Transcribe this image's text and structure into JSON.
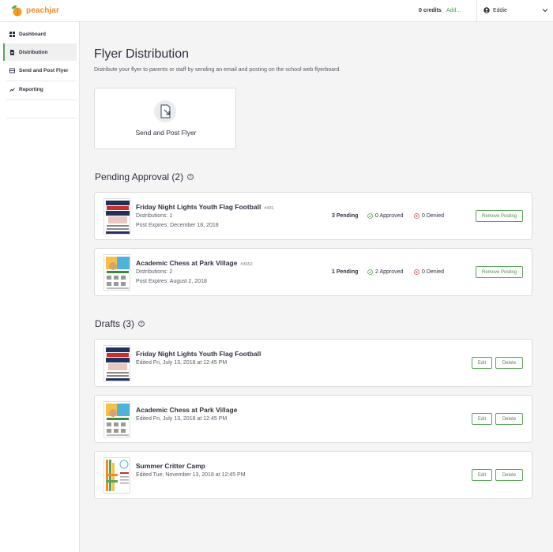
{
  "topbar": {
    "logo_text": "peachjar",
    "credits": "0 credits",
    "add_link": "Add...",
    "user_name": "Eddie"
  },
  "sidebar": {
    "items": [
      {
        "label": "Dashboard",
        "icon": "dashboard-icon",
        "active": false
      },
      {
        "label": "Distribution",
        "icon": "document-icon",
        "active": true
      },
      {
        "label": "Send and Post Flyer",
        "icon": "send-icon",
        "active": false
      },
      {
        "label": "Reporting",
        "icon": "reporting-icon",
        "active": false
      }
    ]
  },
  "main": {
    "title": "Flyer Distribution",
    "subtitle": "Distribute your flyer to parents or staff by sending an email and posting on the school web flyerboard.",
    "send_card_label": "Send and Post Flyer",
    "pending_title": "Pending Approval (2)",
    "drafts_title": "Drafts (3)",
    "pending": [
      {
        "title": "Friday Night Lights Youth Flag Football",
        "id": "#431",
        "distributions": "Distributions: 1",
        "expires": "Post Expires: December 18, 2018",
        "pending": "3 Pending",
        "approved": "0 Approved",
        "denied": "0 Denied",
        "button": "Remove Posting",
        "thumb": "football"
      },
      {
        "title": "Academic Chess at Park Village",
        "id": "#3652",
        "distributions": "Distributions: 2",
        "expires": "Post Expires: August 2, 2018",
        "pending": "1 Pending",
        "approved": "2 Approved",
        "denied": "0 Denied",
        "button": "Remove Posting",
        "thumb": "chess"
      }
    ],
    "drafts": [
      {
        "title": "Friday Night Lights Youth Flag Football",
        "edited": "Edited Fri, July 13, 2018 at 12:45 PM",
        "edit": "Edit",
        "delete": "Delete",
        "thumb": "football"
      },
      {
        "title": "Academic Chess at Park Village",
        "edited": "Edited Fri, July 13, 2018 at 12:45 PM",
        "edit": "Edit",
        "delete": "Delete",
        "thumb": "chess"
      },
      {
        "title": "Summer Critter Camp",
        "edited": "Edited Tue, November 13, 2018 at 12:45 PM",
        "edit": "Edit",
        "delete": "Delete",
        "thumb": "camp"
      }
    ]
  },
  "colors": {
    "accent_green": "#5aa55a",
    "brand_orange": "#f08a24",
    "denied_red": "#d9534f"
  }
}
